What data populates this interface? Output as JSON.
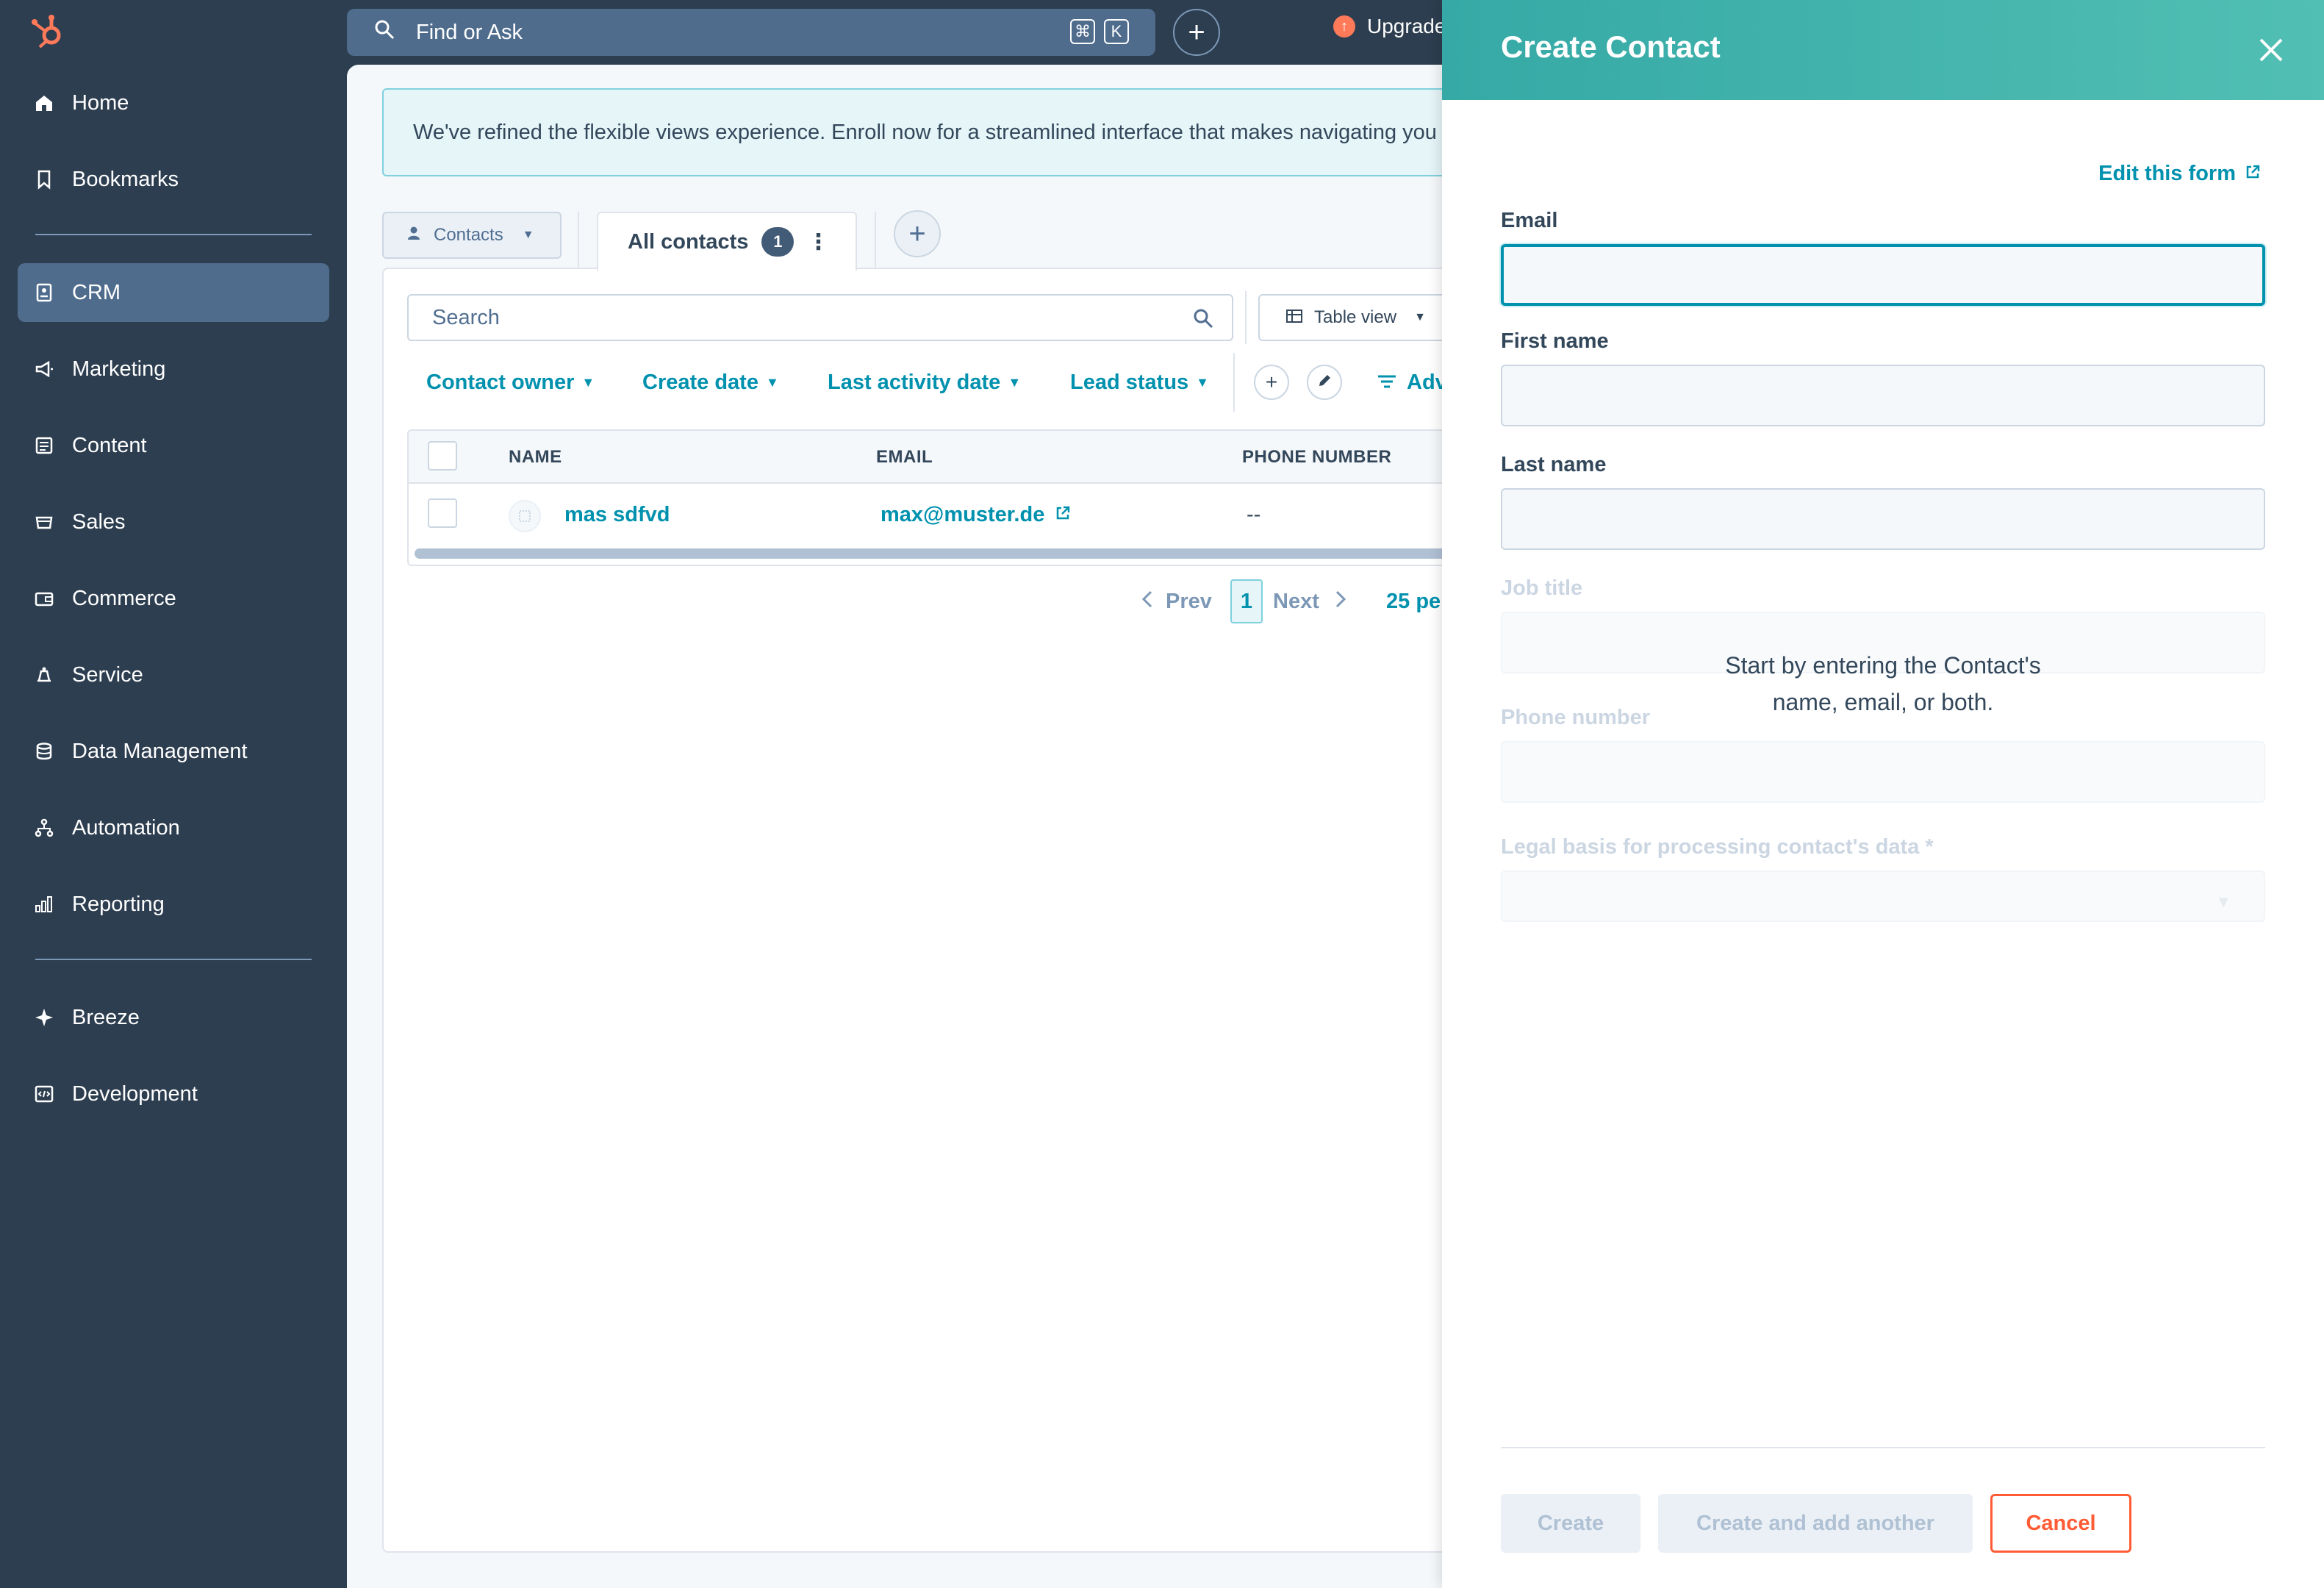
{
  "topbar": {
    "search_placeholder": "Find or Ask",
    "shortcut_keys": [
      "⌘",
      "K"
    ],
    "upgrade_label": "Upgrade"
  },
  "sidebar": {
    "items": [
      {
        "label": "Home",
        "icon": "home-icon"
      },
      {
        "label": "Bookmarks",
        "icon": "bookmark-icon"
      },
      {
        "label": "CRM",
        "icon": "crm-icon",
        "active": true
      },
      {
        "label": "Marketing",
        "icon": "megaphone-icon"
      },
      {
        "label": "Content",
        "icon": "content-icon"
      },
      {
        "label": "Sales",
        "icon": "sales-icon"
      },
      {
        "label": "Commerce",
        "icon": "wallet-icon"
      },
      {
        "label": "Service",
        "icon": "service-icon"
      },
      {
        "label": "Data Management",
        "icon": "database-icon"
      },
      {
        "label": "Automation",
        "icon": "automation-icon"
      },
      {
        "label": "Reporting",
        "icon": "reporting-icon"
      },
      {
        "label": "Breeze",
        "icon": "sparkle-icon"
      },
      {
        "label": "Development",
        "icon": "code-icon"
      }
    ]
  },
  "banner": {
    "text": "We've refined the flexible views experience. Enroll now for a streamlined interface that makes navigating you"
  },
  "views": {
    "object_selector": "Contacts",
    "tab_label": "All contacts",
    "tab_count": "1",
    "search_placeholder": "Search",
    "view_mode": "Table view"
  },
  "filters": {
    "contact_owner": "Contact owner",
    "create_date": "Create date",
    "last_activity_date": "Last activity date",
    "lead_status": "Lead status",
    "advanced": "Adv"
  },
  "table": {
    "columns": [
      "NAME",
      "EMAIL",
      "PHONE NUMBER"
    ],
    "rows": [
      {
        "name": "mas sdfvd",
        "email": "max@muster.de",
        "phone": "--"
      }
    ]
  },
  "pagination": {
    "prev": "Prev",
    "page": "1",
    "next": "Next",
    "per_page": "25 pe"
  },
  "create_contact": {
    "title": "Create Contact",
    "edit_form": "Edit this form",
    "fields": {
      "email": "Email",
      "first_name": "First name",
      "last_name": "Last name",
      "job_title": "Job title",
      "phone_number": "Phone number",
      "legal_basis": "Legal basis for processing contact's data *"
    },
    "hint_line1": "Start by entering the Contact's",
    "hint_line2": "name, email, or both.",
    "buttons": {
      "create": "Create",
      "create_and_add": "Create and add another",
      "cancel": "Cancel"
    }
  },
  "colors": {
    "sidebar_bg": "#2d3e50",
    "accent": "#0091ae",
    "header_teal": "#36a9a6",
    "cancel_orange": "#ff5c35",
    "brand_orange": "#ff7a59"
  }
}
